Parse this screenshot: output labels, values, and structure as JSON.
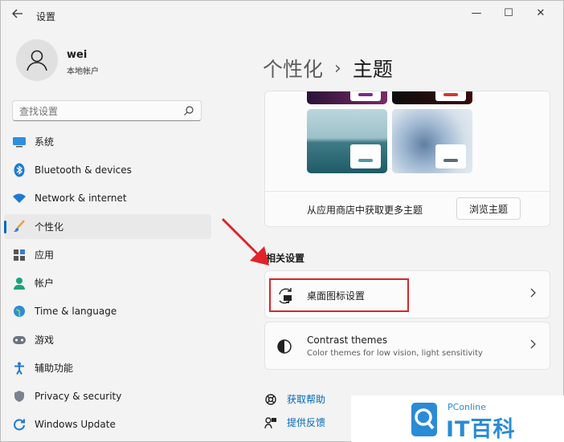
{
  "window": {
    "app_title": "设置",
    "controls": {
      "minimize": "—",
      "maximize": "☐",
      "close": "✕"
    }
  },
  "profile": {
    "name": "wei",
    "account_type": "本地帐户"
  },
  "search": {
    "placeholder": "查找设置"
  },
  "nav": {
    "items": [
      {
        "label": "系统",
        "icon": "monitor-icon"
      },
      {
        "label": "Bluetooth & devices",
        "icon": "bluetooth-icon"
      },
      {
        "label": "Network & internet",
        "icon": "wifi-icon"
      },
      {
        "label": "个性化",
        "icon": "brush-icon",
        "active": true
      },
      {
        "label": "应用",
        "icon": "apps-icon"
      },
      {
        "label": "帐户",
        "icon": "person-icon"
      },
      {
        "label": "Time & language",
        "icon": "globe-icon"
      },
      {
        "label": "游戏",
        "icon": "gamepad-icon"
      },
      {
        "label": "辅助功能",
        "icon": "accessibility-icon"
      },
      {
        "label": "Privacy & security",
        "icon": "shield-icon"
      },
      {
        "label": "Windows Update",
        "icon": "update-icon"
      }
    ]
  },
  "breadcrumb": {
    "parent": "个性化",
    "separator": "›",
    "current": "主题"
  },
  "themes": {
    "store_text": "从应用商店中获取更多主题",
    "browse_button": "浏览主题"
  },
  "related": {
    "section_title": "相关设置",
    "desktop_icons": {
      "title": "桌面图标设置",
      "icon": "desktop-icon-settings-icon"
    },
    "contrast": {
      "title": "Contrast themes",
      "subtitle": "Color themes for low vision, light sensitivity",
      "icon": "contrast-icon"
    }
  },
  "help": {
    "get_help": "获取帮助",
    "feedback": "提供反馈"
  },
  "watermark": {
    "brand": "PConline",
    "text": "IT百科"
  },
  "colors": {
    "accent": "#0067c0",
    "annotation": "#d6262b"
  }
}
